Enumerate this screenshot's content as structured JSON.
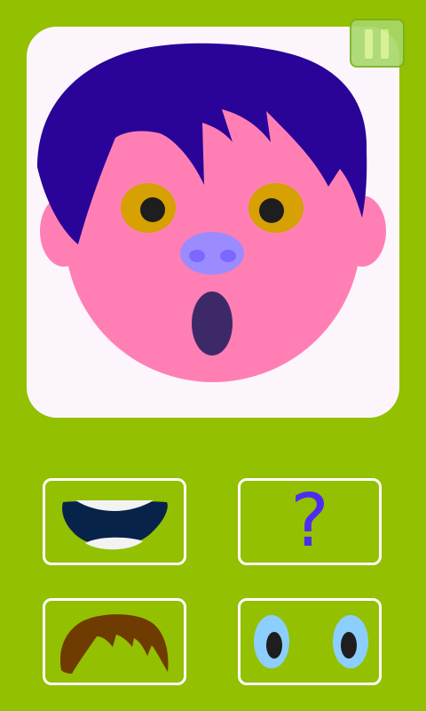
{
  "game": {
    "face": {
      "hair_color": "#2a0398",
      "skin_color": "#ff7fb5",
      "eye_iris_color": "#d7a003",
      "pupil_color": "#1e1e1e",
      "nose_color": "#9a8bff",
      "mouth_color": "#3e2968",
      "card_color": "#fcf6fc"
    },
    "options": {
      "random_label": "?",
      "mouth_icon": "smile-mouth-icon",
      "hair_icon": "brown-hair-icon",
      "eyes_icon": "blue-eyes-icon",
      "random_icon": "question-mark-icon"
    },
    "colors": {
      "background": "#93c000",
      "option_border": "#ffffff",
      "question_mark": "#4d2cf0"
    }
  }
}
